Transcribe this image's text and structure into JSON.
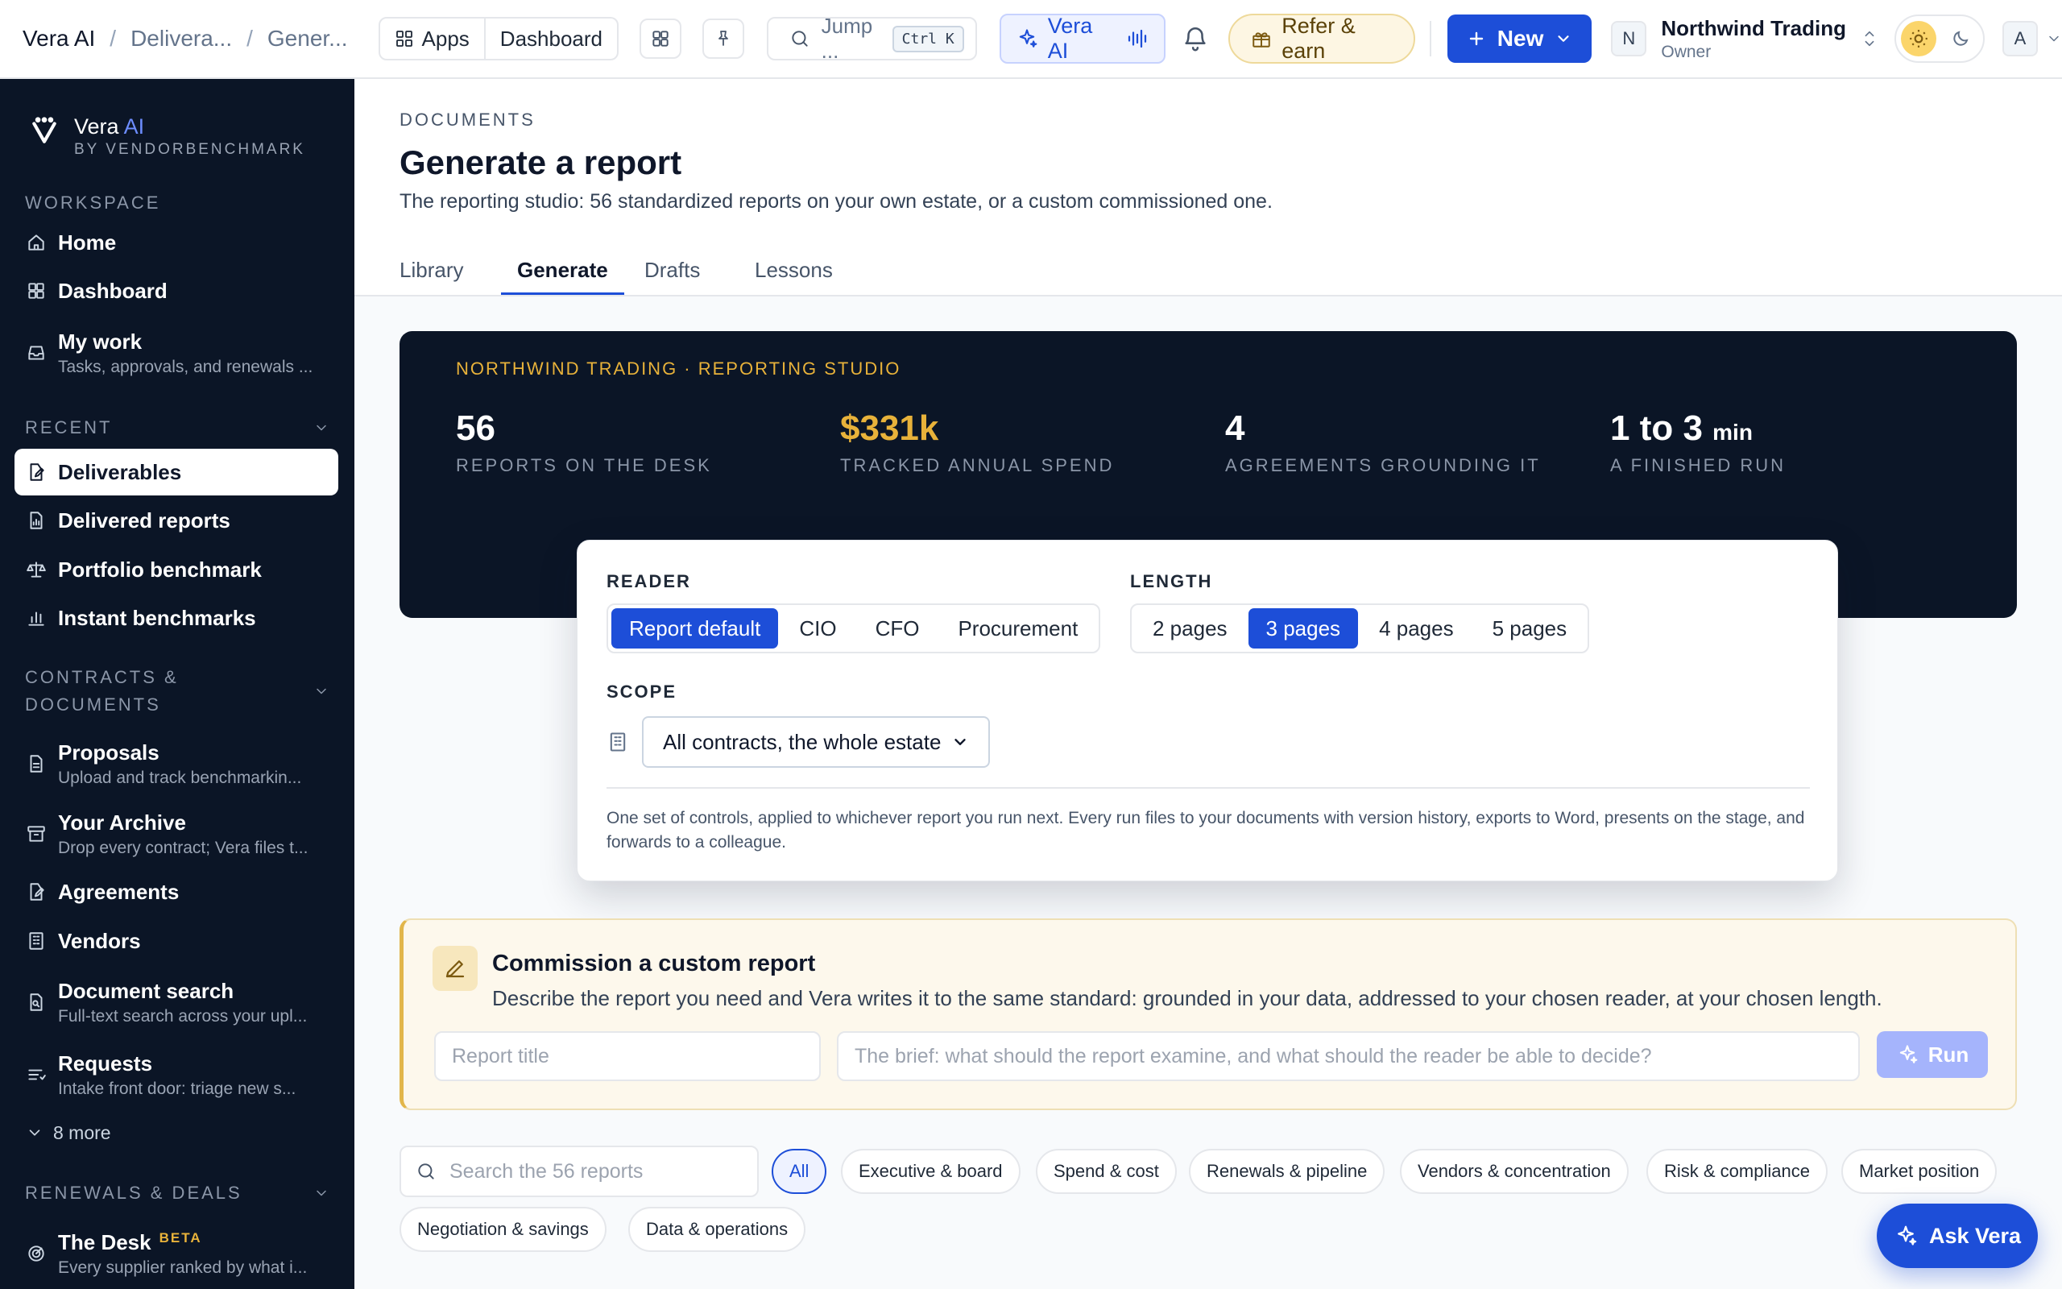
{
  "topbar": {
    "breadcrumbs": [
      "Vera AI",
      "Delivera...",
      "Gener..."
    ],
    "apps_label": "Apps",
    "dashboard_label": "Dashboard",
    "search_placeholder": "Jump ...",
    "search_shortcut": "Ctrl K",
    "vera_label": "Vera AI",
    "refer_label": "Refer & earn",
    "new_label": "New",
    "org_initial": "N",
    "org_name": "Northwind Trading",
    "org_role": "Owner",
    "user_initial": "A"
  },
  "sidebar": {
    "brand_name": "Vera",
    "brand_accent": "AI",
    "brand_sub": "BY VENDORBENCHMARK",
    "sections": {
      "workspace": "WORKSPACE",
      "recent": "RECENT",
      "contracts": "CONTRACTS & DOCUMENTS",
      "renewals": "RENEWALS & DEALS"
    },
    "items": {
      "home": "Home",
      "dashboard": "Dashboard",
      "my_work": {
        "title": "My work",
        "sub": "Tasks, approvals, and renewals ..."
      },
      "deliverables": "Deliverables",
      "delivered_reports": "Delivered reports",
      "portfolio_benchmark": "Portfolio benchmark",
      "instant_benchmarks": "Instant benchmarks",
      "proposals": {
        "title": "Proposals",
        "sub": "Upload and track benchmarkin..."
      },
      "archive": {
        "title": "Your Archive",
        "sub": "Drop every contract; Vera files t..."
      },
      "agreements": "Agreements",
      "vendors": "Vendors",
      "document_search": {
        "title": "Document search",
        "sub": "Full-text search across your upl..."
      },
      "requests": {
        "title": "Requests",
        "sub": "Intake front door: triage new s..."
      },
      "more": "8 more",
      "the_desk": {
        "title": "The Desk",
        "badge": "BETA",
        "sub": "Every supplier ranked by what i..."
      }
    }
  },
  "page": {
    "eyebrow": "DOCUMENTS",
    "title": "Generate a report",
    "subtitle": "The reporting studio: 56 standardized reports on your own estate, or a custom commissioned one.",
    "tabs": [
      "Library",
      "Generate",
      "Drafts",
      "Lessons"
    ],
    "active_tab": "Generate"
  },
  "hero": {
    "eyebrow": "NORTHWIND TRADING · REPORTING STUDIO",
    "stats": [
      {
        "value": "56",
        "label": "REPORTS ON THE DESK"
      },
      {
        "value": "$331k",
        "label": "TRACKED ANNUAL SPEND"
      },
      {
        "value": "4",
        "label": "AGREEMENTS GROUNDING IT"
      },
      {
        "value": "1 to 3",
        "unit": "min",
        "label": "A FINISHED RUN"
      }
    ]
  },
  "controls": {
    "reader_label": "READER",
    "reader_options": [
      "Report default",
      "CIO",
      "CFO",
      "Procurement"
    ],
    "reader_selected": "Report default",
    "length_label": "LENGTH",
    "length_options": [
      "2 pages",
      "3 pages",
      "4 pages",
      "5 pages"
    ],
    "length_selected": "3 pages",
    "scope_label": "SCOPE",
    "scope_value": "All contracts, the whole estate",
    "note": "One set of controls, applied to whichever report you run next. Every run files to your documents with version history, exports to Word, presents on the stage, and forwards to a colleague."
  },
  "commission": {
    "title": "Commission a custom report",
    "description": "Describe the report you need and Vera writes it to the same standard: grounded in your data, addressed to your chosen reader, at your chosen length.",
    "title_placeholder": "Report title",
    "brief_placeholder": "The brief: what should the report examine, and what should the reader be able to decide?",
    "run_label": "Run"
  },
  "filters": {
    "search_placeholder": "Search the 56 reports",
    "chips": [
      "All",
      "Executive & board",
      "Spend & cost",
      "Renewals & pipeline",
      "Vendors & concentration",
      "Risk & compliance",
      "Market position",
      "Negotiation & savings",
      "Data & operations"
    ],
    "active": "All"
  },
  "ask_vera": "Ask Vera",
  "colors": {
    "accent": "#1d4ed8",
    "sidebar_bg": "#0b1526",
    "gold": "#e8b23a",
    "brand_ai": "#6d8dff"
  }
}
